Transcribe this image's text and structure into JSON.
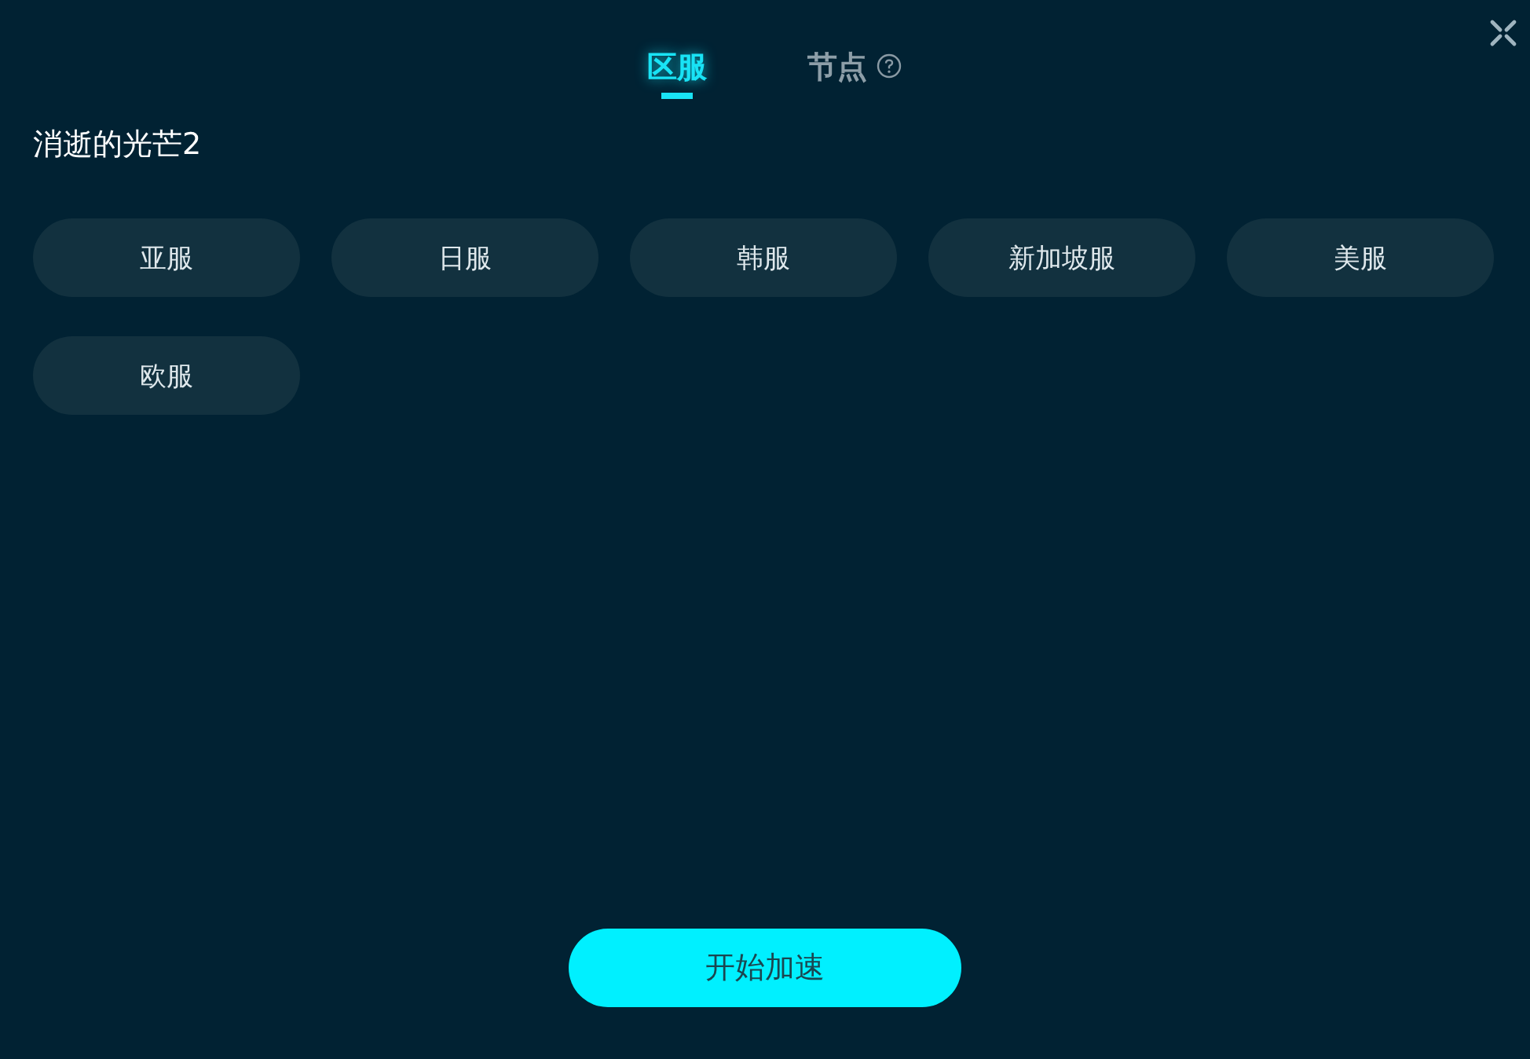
{
  "tabs": [
    {
      "label": "区服",
      "selected": true,
      "help": false
    },
    {
      "label": "节点",
      "selected": false,
      "help": true
    }
  ],
  "game_title": "消逝的光芒2",
  "servers": [
    "亚服",
    "日服",
    "韩服",
    "新加坡服",
    "美服",
    "欧服"
  ],
  "start_button": "开始加速"
}
